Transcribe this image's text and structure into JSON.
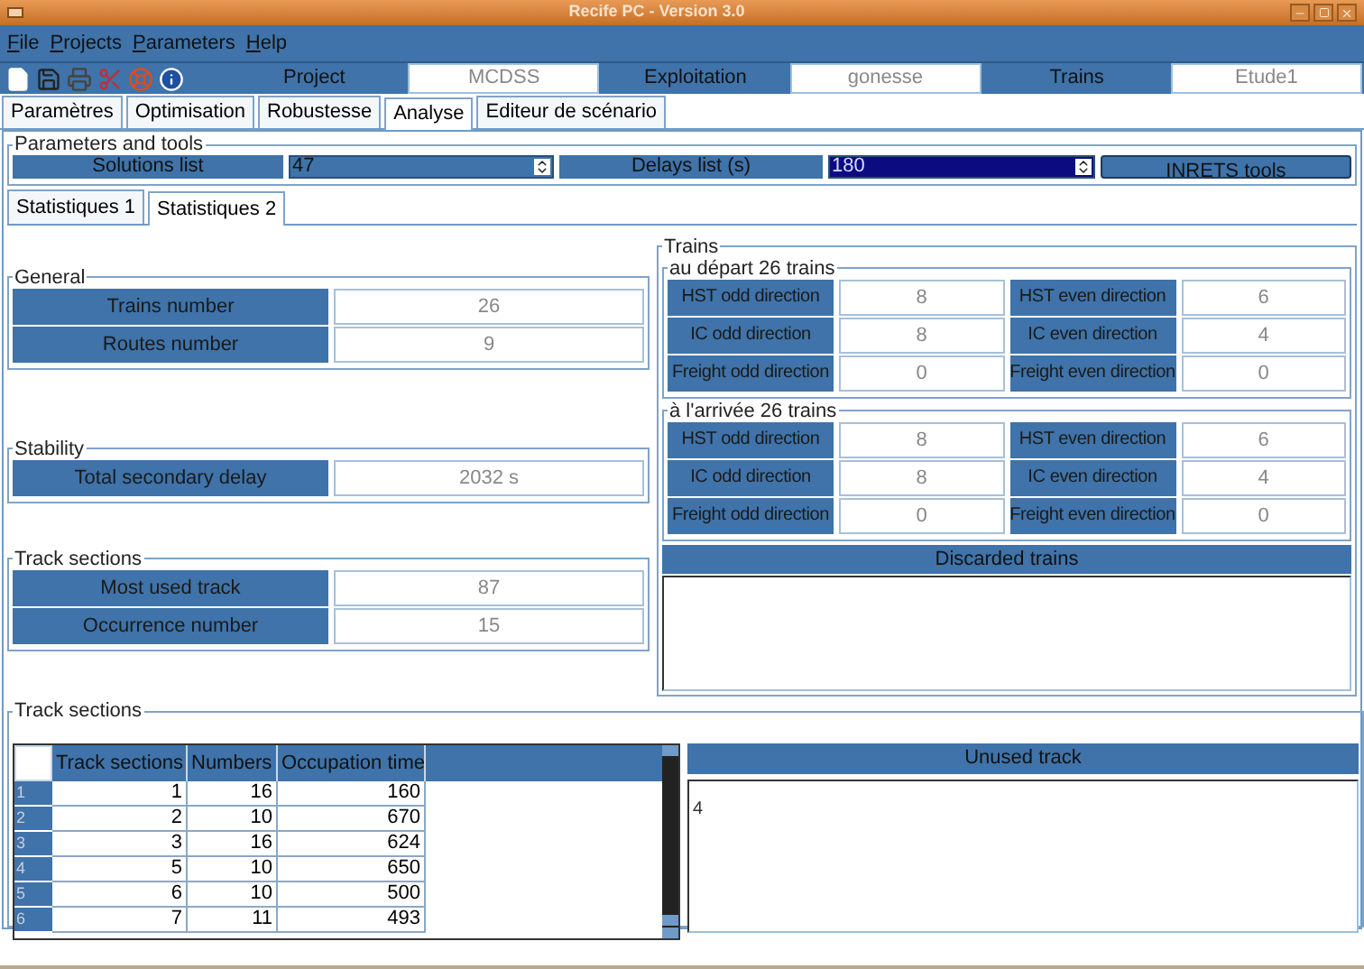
{
  "window": {
    "title": "Recife PC - Version 3.0"
  },
  "menu": [
    "File",
    "Projects",
    "Parameters",
    "Help"
  ],
  "toolbar_fields": [
    {
      "label": "Project",
      "value": "MCDSS"
    },
    {
      "label": "Exploitation",
      "value": "gonesse"
    },
    {
      "label": "Trains",
      "value": "Etude1"
    }
  ],
  "tabs": [
    {
      "label": "Paramètres",
      "selected": false
    },
    {
      "label": "Optimisation",
      "selected": false
    },
    {
      "label": "Robustesse",
      "selected": false
    },
    {
      "label": "Analyse",
      "selected": true
    },
    {
      "label": "Editeur de scénario",
      "selected": false
    }
  ],
  "parameters_and_tools": {
    "title": "Parameters and tools",
    "solutions_label": "Solutions list",
    "solutions_value": "47",
    "delays_label": "Delays list (s)",
    "delays_value": "180",
    "tools_button": "INRETS tools"
  },
  "subtabs": [
    {
      "label": "Statistiques 1",
      "selected": false
    },
    {
      "label": "Statistiques 2",
      "selected": true
    }
  ],
  "general": {
    "title": "General",
    "rows": [
      {
        "label": "Trains number",
        "value": "26"
      },
      {
        "label": "Routes number",
        "value": "9"
      }
    ]
  },
  "stability": {
    "title": "Stability",
    "rows": [
      {
        "label": "Total secondary delay",
        "value": "2032 s"
      }
    ]
  },
  "track_summary": {
    "title": "Track sections",
    "rows": [
      {
        "label": "Most used track",
        "value": "87"
      },
      {
        "label": "Occurrence number",
        "value": "15"
      }
    ]
  },
  "trains": {
    "title": "Trains",
    "groups": [
      {
        "title": "au départ 26 trains",
        "rows": [
          {
            "label": "HST odd direction",
            "value": "8"
          },
          {
            "label": "HST even direction",
            "value": "6"
          },
          {
            "label": "IC odd direction",
            "value": "8"
          },
          {
            "label": "IC even direction",
            "value": "4"
          },
          {
            "label": "Freight odd direction",
            "value": "0"
          },
          {
            "label": "Freight even direction",
            "value": "0"
          }
        ]
      },
      {
        "title": "à l'arrivée 26 trains",
        "rows": [
          {
            "label": "HST odd direction",
            "value": "8"
          },
          {
            "label": "HST even direction",
            "value": "6"
          },
          {
            "label": "IC odd direction",
            "value": "8"
          },
          {
            "label": "IC even direction",
            "value": "4"
          },
          {
            "label": "Freight odd direction",
            "value": "0"
          },
          {
            "label": "Freight even direction",
            "value": "0"
          }
        ]
      }
    ],
    "discarded_title": "Discarded trains"
  },
  "track_sections": {
    "title": "Track sections",
    "columns": [
      "Track sections",
      "Numbers",
      "Occupation time"
    ],
    "rows": [
      {
        "index": "1",
        "cells": [
          "1",
          "16",
          "160"
        ]
      },
      {
        "index": "2",
        "cells": [
          "2",
          "10",
          "670"
        ]
      },
      {
        "index": "3",
        "cells": [
          "3",
          "16",
          "624"
        ]
      },
      {
        "index": "4",
        "cells": [
          "5",
          "10",
          "650"
        ]
      },
      {
        "index": "5",
        "cells": [
          "6",
          "10",
          "500"
        ]
      },
      {
        "index": "6",
        "cells": [
          "7",
          "11",
          "493"
        ]
      }
    ],
    "unused_title": "Unused track",
    "unused_value": "4"
  }
}
